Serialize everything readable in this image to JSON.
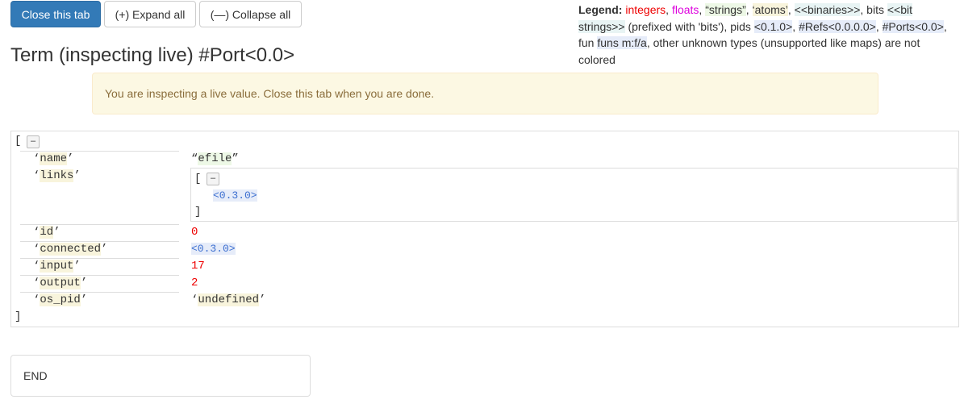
{
  "toolbar": {
    "close_label": "Close this tab",
    "expand_label": "(+) Expand all",
    "collapse_label": "(—) Collapse all"
  },
  "title": "Term (inspecting live) #Port<0.0>",
  "legend": {
    "label": "Legend:",
    "integers": "integers",
    "sep1": ", ",
    "floats": "floats",
    "sep2": ", ",
    "strings": "“strings”",
    "sep3": ", ",
    "atoms": "‘atoms’",
    "sep4": ", ",
    "binaries": "<<binaries>>",
    "sep5": ", bits ",
    "bitstrings": "<<bit strings>>",
    "sep6": " (prefixed with 'bits'), pids ",
    "pid": "<0.1.0>",
    "sep7": ", ",
    "refs": "#Refs<0.0.0.0>",
    "sep8": ", ",
    "ports": "#Ports<0.0>",
    "sep9": ", fun ",
    "funs": "funs m:f/a",
    "sep10": ", other unknown types (unsupported like maps) are not colored"
  },
  "alert": "You are inspecting a live value. Close this tab when you are done.",
  "term": {
    "open_bracket": "[",
    "close_bracket": "]",
    "toggle": "–",
    "rows": {
      "name": {
        "key": "name",
        "value": "efile"
      },
      "links": {
        "key": "links",
        "open": "[",
        "close": "]",
        "item": "<0.3.0>"
      },
      "id": {
        "key": "id",
        "value": "0"
      },
      "connected": {
        "key": "connected",
        "value": "<0.3.0>"
      },
      "input": {
        "key": "input",
        "value": "17"
      },
      "output": {
        "key": "output",
        "value": "2"
      },
      "os_pid": {
        "key": "os_pid",
        "value": "undefined"
      }
    }
  },
  "end_label": "END",
  "colors": {
    "primary": "#337ab7",
    "integer": "#ee0000",
    "float": "#dd00dd",
    "alert_bg": "#fcf8e3",
    "alert_text": "#8a6d3b"
  }
}
